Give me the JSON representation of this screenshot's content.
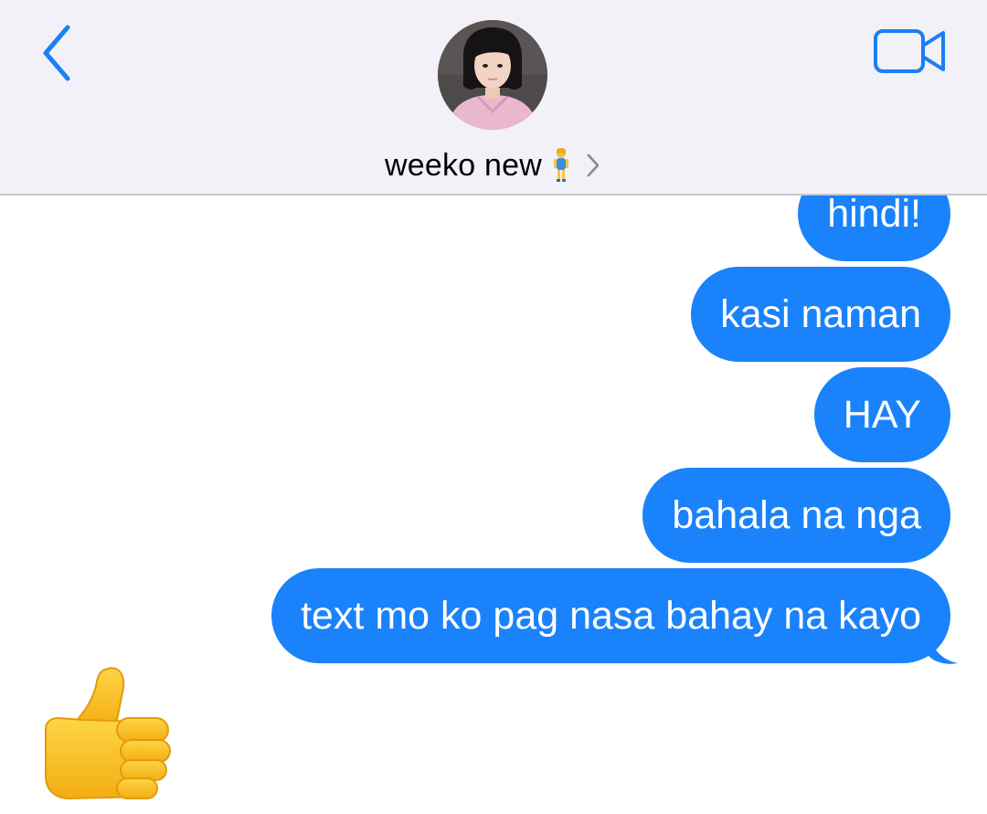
{
  "header": {
    "contact_name": "weeko new",
    "contact_emoji_icon": "standing-woman-emoji",
    "back_icon": "chevron-left-icon",
    "video_icon": "video-camera-icon",
    "name_chevron_icon": "chevron-right-icon"
  },
  "messages": [
    {
      "text": "hindi!",
      "sender": "me"
    },
    {
      "text": "kasi naman",
      "sender": "me"
    },
    {
      "text": "HAY",
      "sender": "me"
    },
    {
      "text": "bahala na nga",
      "sender": "me"
    },
    {
      "text": "text mo ko pag nasa bahay na kayo",
      "sender": "me"
    }
  ],
  "reply": {
    "type": "emoji",
    "icon": "thumbs-up-emoji"
  },
  "colors": {
    "accent": "#1a82fb",
    "header_bg": "#f2f1f7",
    "tint": "#1a7ff6"
  }
}
